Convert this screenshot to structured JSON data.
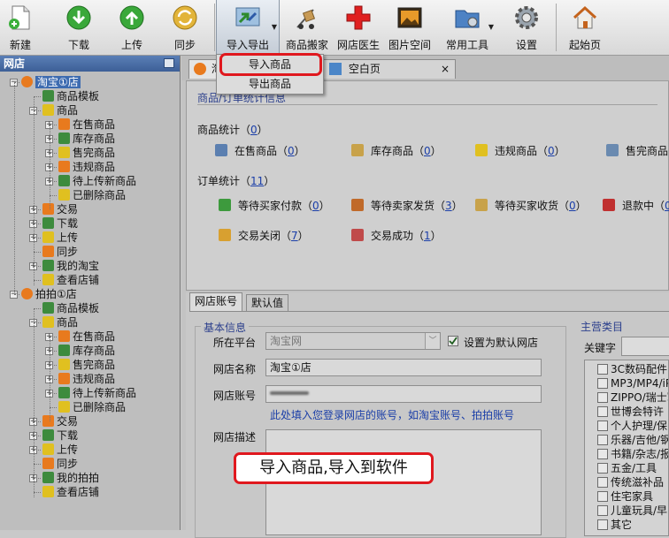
{
  "toolbar": {
    "items": [
      {
        "label": "新建",
        "icon": "new-document-icon"
      },
      {
        "label": "下载",
        "icon": "download-icon"
      },
      {
        "label": "上传",
        "icon": "upload-icon"
      },
      {
        "label": "同步",
        "icon": "sync-icon"
      },
      {
        "label": "导入导出",
        "icon": "import-export-icon"
      },
      {
        "label": "商品搬家",
        "icon": "move-goods-icon"
      },
      {
        "label": "网店医生",
        "icon": "shop-doctor-icon"
      },
      {
        "label": "图片空间",
        "icon": "picture-space-icon"
      },
      {
        "label": "常用工具",
        "icon": "tools-folder-icon"
      },
      {
        "label": "设置",
        "icon": "gear-icon"
      },
      {
        "label": "起始页",
        "icon": "home-icon"
      }
    ]
  },
  "menu": {
    "import_label": "导入商品",
    "export_label": "导出商品"
  },
  "left_panel": {
    "title": "网店",
    "tree": [
      {
        "label": "淘宝①店",
        "level": 0
      },
      {
        "label": "商品模板",
        "level": 1
      },
      {
        "label": "商品",
        "level": 1
      },
      {
        "label": "在售商品",
        "level": 2
      },
      {
        "label": "库存商品",
        "level": 2
      },
      {
        "label": "售完商品",
        "level": 2
      },
      {
        "label": "违规商品",
        "level": 2
      },
      {
        "label": "待上传新商品",
        "level": 2
      },
      {
        "label": "已删除商品",
        "level": 2
      },
      {
        "label": "交易",
        "level": 1
      },
      {
        "label": "下载",
        "level": 1
      },
      {
        "label": "上传",
        "level": 1
      },
      {
        "label": "同步",
        "level": 1
      },
      {
        "label": "我的淘宝",
        "level": 1
      },
      {
        "label": "查看店铺",
        "level": 1
      },
      {
        "label": "拍拍①店",
        "level": 0
      },
      {
        "label": "商品模板",
        "level": 1
      },
      {
        "label": "商品",
        "level": 1
      },
      {
        "label": "在售商品",
        "level": 2
      },
      {
        "label": "库存商品",
        "level": 2
      },
      {
        "label": "售完商品",
        "level": 2
      },
      {
        "label": "违规商品",
        "level": 2
      },
      {
        "label": "待上传新商品",
        "level": 2
      },
      {
        "label": "已删除商品",
        "level": 2
      },
      {
        "label": "交易",
        "level": 1
      },
      {
        "label": "下载",
        "level": 1
      },
      {
        "label": "上传",
        "level": 1
      },
      {
        "label": "同步",
        "level": 1
      },
      {
        "label": "我的拍拍",
        "level": 1
      },
      {
        "label": "查看店铺",
        "level": 1
      }
    ]
  },
  "tabs": [
    {
      "label": "淘",
      "close": "×"
    },
    {
      "label": "空白页",
      "close": "×"
    }
  ],
  "stats": {
    "section_title": "商品/订单统计信息",
    "goods_label": "商品统计（",
    "goods_count": "0",
    "goods": [
      {
        "label": "在售商品（",
        "count": "0"
      },
      {
        "label": "库存商品（",
        "count": "0"
      },
      {
        "label": "违规商品（",
        "count": "0"
      },
      {
        "label": "售完商品",
        "count": ""
      }
    ],
    "orders_label": "订单统计（",
    "orders_count": "11",
    "orders": [
      {
        "label": "等待买家付款（",
        "count": "0"
      },
      {
        "label": "等待卖家发货（",
        "count": "3"
      },
      {
        "label": "等待买家收货（",
        "count": "0"
      },
      {
        "label": "退款中（",
        "count": "0"
      },
      {
        "label": "交易关闭（",
        "count": "7"
      },
      {
        "label": "交易成功（",
        "count": "1"
      }
    ],
    "close_paren": "）"
  },
  "bottom": {
    "tab_account": "网店账号",
    "tab_default": "默认值",
    "basic_info_title": "基本信息",
    "platform_label": "所在平台",
    "platform_value": "淘宝网",
    "default_shop_label": "设置为默认网店",
    "shop_name_label": "网店名称",
    "shop_name_value": "淘宝①店",
    "account_label": "网店账号",
    "account_hint": "此处填入您登录网店的账号，如淘宝账号、拍拍账号",
    "desc_label": "网店描述",
    "category_title": "主营类目",
    "keyword_label": "关键字",
    "categories": [
      "3C数码配件",
      "MP3/MP4/iPo",
      "ZIPPO/瑞士军",
      "世博会特许",
      "个人护理/保",
      "乐器/吉他/钢",
      "书籍/杂志/报",
      "五金/工具",
      "传统滋补品",
      "住宅家具",
      "儿童玩具/早",
      "其它"
    ]
  },
  "callout": {
    "text": "导入商品,导入到软件"
  }
}
